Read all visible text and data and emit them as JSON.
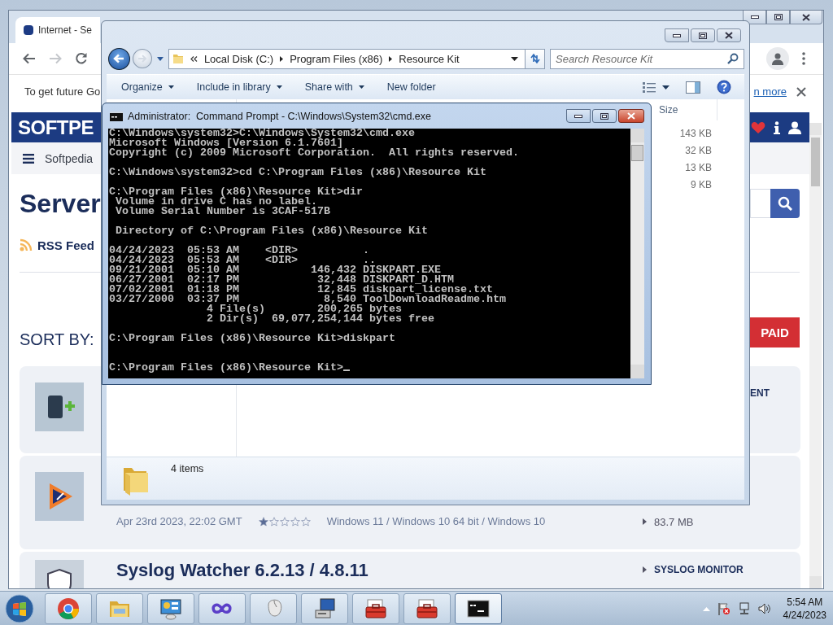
{
  "browser": {
    "tab": {
      "title": "Internet - Se"
    },
    "navigation": {
      "forward_disabled": true
    },
    "infobar": {
      "text": "To get future Go",
      "link": "n more"
    },
    "page": {
      "logo": "SOFTPE",
      "breadcrumb": "Softpedia",
      "heading": "Server",
      "rss": "RSS Feed",
      "sort_label": "SORT BY:",
      "paid_button": "PAID",
      "items": [
        {
          "kind": "label_only",
          "category": "ENT"
        },
        {
          "kind": "meta",
          "date": "Apr 23rd 2023, 22:02 GMT",
          "stars": 1,
          "platforms": "Windows 11 / Windows 10 64 bit / Windows 10",
          "size": "83.7 MB"
        },
        {
          "kind": "title",
          "title": "Syslog Watcher 6.2.13 / 4.8.11",
          "category": "SYSLOG MONITOR"
        }
      ]
    }
  },
  "explorer": {
    "forward_disabled": true,
    "path": [
      "Local Disk (C:)",
      "Program Files (x86)",
      "Resource Kit"
    ],
    "search_placeholder": "Search Resource Kit",
    "commands": [
      {
        "label": "Organize",
        "dropdown": true
      },
      {
        "label": "Include in library",
        "dropdown": true
      },
      {
        "label": "Share with",
        "dropdown": true
      },
      {
        "label": "New folder",
        "dropdown": false
      }
    ],
    "columns": [
      "Size"
    ],
    "rows": [
      {
        "size": "143 KB"
      },
      {
        "size": "32 KB"
      },
      {
        "size": "13 KB"
      },
      {
        "size": "9 KB"
      }
    ],
    "status": "4 items"
  },
  "console": {
    "title": "Administrator:  Command Prompt - C:\\Windows\\System32\\cmd.exe",
    "cursor": true,
    "blocks": [
      {
        "lines": [
          "C:\\Windows\\system32>C:\\Windows\\System32\\cmd.exe",
          "Microsoft Windows [Version 6.1.7601]",
          "Copyright (c) 2009 Microsoft Corporation.  All rights reserved."
        ]
      },
      {
        "lines": [
          "C:\\Windows\\system32>cd C:\\Program Files (x86)\\Resource Kit"
        ]
      },
      {
        "lines": [
          "C:\\Program Files (x86)\\Resource Kit>dir",
          " Volume in drive C has no label.",
          " Volume Serial Number is 3CAF-517B"
        ]
      },
      {
        "lines": [
          " Directory of C:\\Program Files (x86)\\Resource Kit"
        ]
      },
      {
        "lines": [
          "04/24/2023  05:53 AM    <DIR>          .",
          "04/24/2023  05:53 AM    <DIR>          ..",
          "09/21/2001  05:10 AM           146,432 DISKPART.EXE",
          "06/27/2001  02:17 PM            32,448 DISKPART_D.HTM",
          "07/02/2001  01:18 PM            12,845 diskpart_license.txt",
          "03/27/2000  03:37 PM             8,540 ToolDownloadReadme.htm",
          "               4 File(s)        200,265 bytes",
          "               2 Dir(s)  69,077,254,144 bytes free"
        ]
      },
      {
        "lines": [
          "C:\\Program Files (x86)\\Resource Kit>diskpart"
        ]
      },
      {
        "extra_blank_line": true,
        "lines": [
          "C:\\Program Files (x86)\\Resource Kit>"
        ]
      }
    ]
  },
  "taskbar": {
    "buttons": [
      {
        "kind": "browser",
        "active": false
      },
      {
        "kind": "folder",
        "active": false
      },
      {
        "kind": "control_panel",
        "active": false
      },
      {
        "kind": "infinity",
        "active": false
      },
      {
        "kind": "mouse",
        "active": false
      },
      {
        "kind": "computer",
        "active": false
      },
      {
        "kind": "toolbox",
        "active": false
      },
      {
        "kind": "toolbox",
        "active": false
      },
      {
        "kind": "console",
        "active": true
      }
    ],
    "clock": {
      "time": "5:54 AM",
      "date": "4/24/2023"
    }
  }
}
